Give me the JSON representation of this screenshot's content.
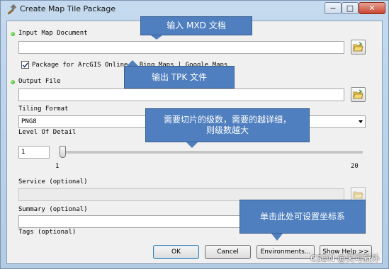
{
  "window": {
    "title": "Create Map Tile Package",
    "controls": {
      "minimize": "−",
      "maximize": "□",
      "close": "✕"
    }
  },
  "form": {
    "input_map": {
      "label": "Input Map Document",
      "value": ""
    },
    "package_option": {
      "label": "Package for ArcGIS Online | Bing Maps | Google Maps",
      "checked": true
    },
    "output_file": {
      "label": "Output File",
      "value": ""
    },
    "tiling_format": {
      "label": "Tiling Format",
      "value": "PNG8"
    },
    "level_of_detail": {
      "label": "Level Of Detail",
      "value": "1",
      "min_label": "1",
      "max_label": "20",
      "level_fraction": 0.0
    },
    "service": {
      "label": "Service (optional)",
      "value": ""
    },
    "summary": {
      "label": "Summary (optional)",
      "value": ""
    },
    "tags": {
      "label": "Tags (optional)"
    }
  },
  "buttons": {
    "ok": "OK",
    "cancel": "Cancel",
    "environments": "Environments...",
    "show_help": "Show Help >>"
  },
  "callouts": {
    "mxd": "输入 MXD 文档",
    "tpk": "输出 TPK 文件",
    "levels_line1": "需要切片的级数，需要的越详细，",
    "levels_line2": "则级数越大",
    "coords": "单击此处可设置坐标系"
  },
  "watermark": "CSDN @天可新外",
  "icons": {
    "title": "tool-hammer-icon",
    "folder": "open-folder-icon",
    "required": "green-dot-icon"
  }
}
